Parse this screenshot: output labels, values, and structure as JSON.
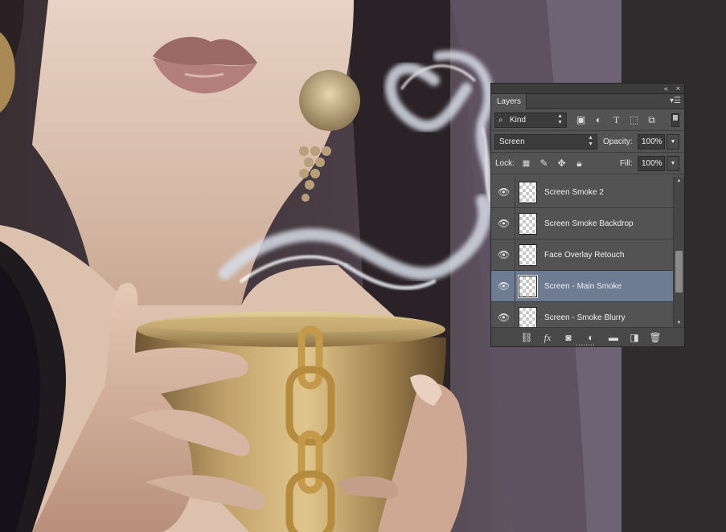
{
  "panel": {
    "collapse_icon": "double-chevron-left-icon",
    "close_icon": "close-icon",
    "tab_label": "Layers",
    "filter": {
      "kind_label": "Kind",
      "search_icon": "search-icon",
      "filter_icons": [
        "image-filter-icon",
        "adjustment-filter-icon",
        "type-filter-icon",
        "shape-filter-icon",
        "smart-object-filter-icon"
      ]
    },
    "blend": {
      "mode": "Screen",
      "opacity_label": "Opacity:",
      "opacity_value": "100%"
    },
    "lock": {
      "label": "Lock:",
      "fill_label": "Fill:",
      "fill_value": "100%"
    },
    "layers": [
      {
        "name": "Screen Smoke 2",
        "visible": true,
        "selected": false
      },
      {
        "name": "Screen Smoke Backdrop",
        "visible": true,
        "selected": false
      },
      {
        "name": "Face Overlay Retouch",
        "visible": true,
        "selected": false
      },
      {
        "name": "Screen - Main Smoke",
        "visible": true,
        "selected": true
      },
      {
        "name": "Screen - Smoke Blurry",
        "visible": true,
        "selected": false
      }
    ],
    "footer_icons": [
      "link-icon",
      "fx-icon",
      "mask-icon",
      "adjustment-layer-icon",
      "folder-icon",
      "new-layer-icon",
      "trash-icon"
    ]
  },
  "colors": {
    "panel_bg": "#535353",
    "selected_row": "#6f7b93",
    "pasteboard": "#2f2c2e"
  }
}
